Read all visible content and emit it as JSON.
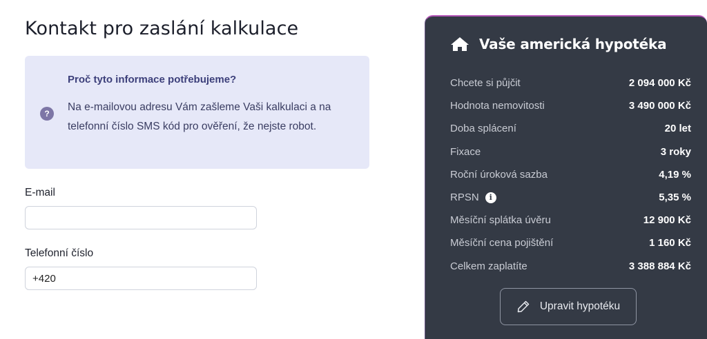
{
  "page_title": "Kontakt pro zaslání kalkulace",
  "info_box": {
    "icon": "question-icon",
    "icon_glyph": "?",
    "title": "Proč tyto informace potřebujeme?",
    "text": "Na e-mailovou adresu Vám zašleme Vaši kalkulaci a na telefonní číslo SMS kód pro ověření, že nejste robot."
  },
  "form": {
    "email": {
      "label": "E-mail",
      "value": ""
    },
    "phone": {
      "label": "Telefonní číslo",
      "value": "+420"
    }
  },
  "summary": {
    "icon": "house-icon",
    "title": "Vaše americká hypotéka",
    "rows": [
      {
        "label": "Chcete si půjčit",
        "value": "2 094 000 Kč"
      },
      {
        "label": "Hodnota nemovitosti",
        "value": "3 490 000 Kč"
      },
      {
        "label": "Doba splácení",
        "value": "20 let"
      },
      {
        "label": "Fixace",
        "value": "3 roky"
      },
      {
        "label": "Roční úroková sazba",
        "value": "4,19 %"
      },
      {
        "label": "RPSN",
        "value": "5,35 %",
        "info_glyph": "i"
      },
      {
        "label": "Měsíční splátka úvěru",
        "value": "12 900 Kč"
      },
      {
        "label": "Měsíční cena pojištění",
        "value": "1 160 Kč"
      },
      {
        "label": "Celkem zaplatíte",
        "value": "3 388 884 Kč"
      }
    ],
    "edit_button": {
      "icon": "pencil-icon",
      "label": "Upravit hypotéku"
    }
  },
  "colors": {
    "panel_bg": "#343a45",
    "panel_border": "#b455b7",
    "info_bg": "#e6e8f8",
    "info_title": "#3c3f7a"
  }
}
